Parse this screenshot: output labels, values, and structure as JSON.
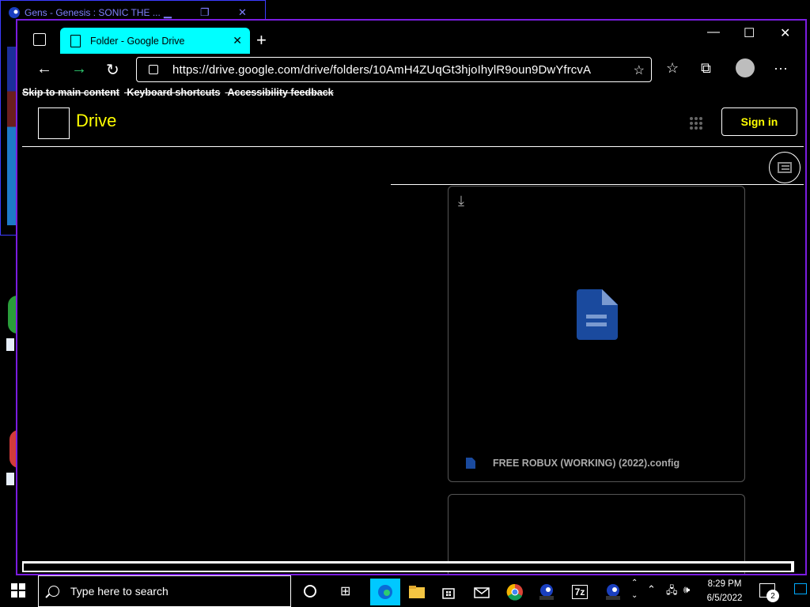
{
  "background_window": {
    "title": "Gens - Genesis : SONIC THE ..."
  },
  "browser": {
    "tab": {
      "title": "Folder - Google Drive",
      "close_label": "✕"
    },
    "new_tab_label": "+",
    "window_controls": {
      "minimize": "—",
      "maximize": "☐",
      "close": "✕"
    },
    "address_bar": {
      "url": "https://drive.google.com/drive/folders/10AmH4ZUqGt3hjoIhylR9oun9DwYfrcvA"
    },
    "more_label": "···"
  },
  "page": {
    "skip_links": [
      "Skip to main content",
      "Keyboard shortcuts",
      "Accessibility feedback"
    ],
    "brand": "Drive",
    "sign_in_label": "Sign in",
    "files": [
      {
        "name": "FREE ROBUX (WORKING) (2022).config",
        "type": "document"
      }
    ]
  },
  "taskbar": {
    "search_placeholder": "Type here to search",
    "apps": [
      "edge",
      "file-explorer",
      "store",
      "mail",
      "chrome",
      "gens",
      "7zip",
      "gens"
    ],
    "app_labels": {
      "7zip": "7z"
    },
    "clock": {
      "time": "8:29 PM",
      "date": "6/5/2022"
    },
    "notifications_count": "2"
  },
  "colors": {
    "accent_tab": "#00ffff",
    "brand_text": "#ffff00",
    "window_border": "#7a1ce0",
    "doc_icon": "#1a4a9e"
  }
}
